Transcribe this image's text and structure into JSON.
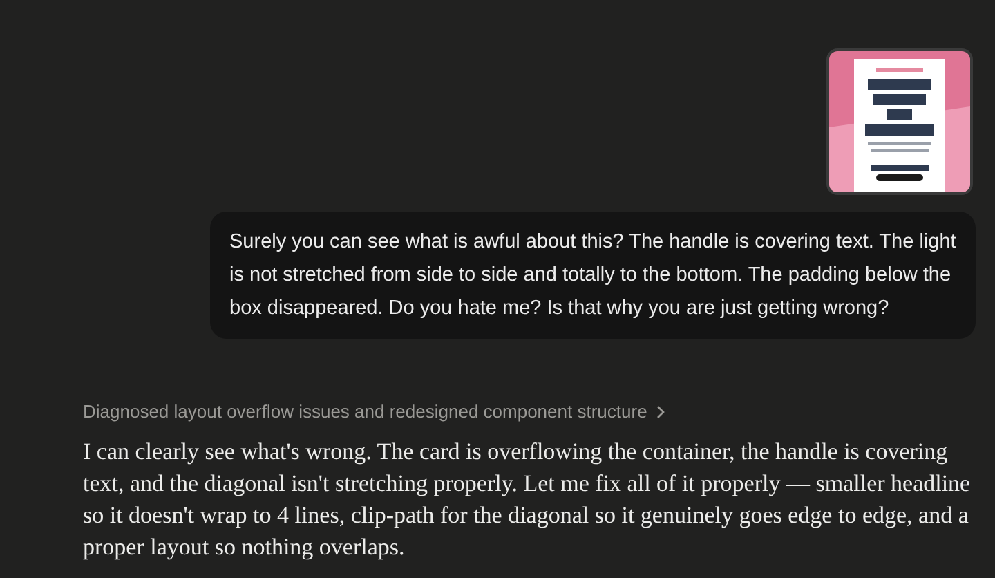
{
  "user_message": {
    "text": "Surely you can see what is awful about this? The handle is covering text. The light is not stretched from side to side and totally to the bottom. The padding below the box disappeared. Do you hate me? Is that why you are just getting wrong?"
  },
  "assistant": {
    "thinking_summary": {
      "text": "Diagnosed layout overflow issues and redesigned component structure",
      "expanded": false
    },
    "reply": "I can clearly see what's wrong. The card is overflowing the container, the handle is covering text, and the diagonal isn't stretching properly. Let me fix all of it properly — smaller headline so it doesn't wrap to 4 lines, clip-path for the diagonal so it genuinely goes edge to edge, and a proper layout so nothing overlaps."
  }
}
